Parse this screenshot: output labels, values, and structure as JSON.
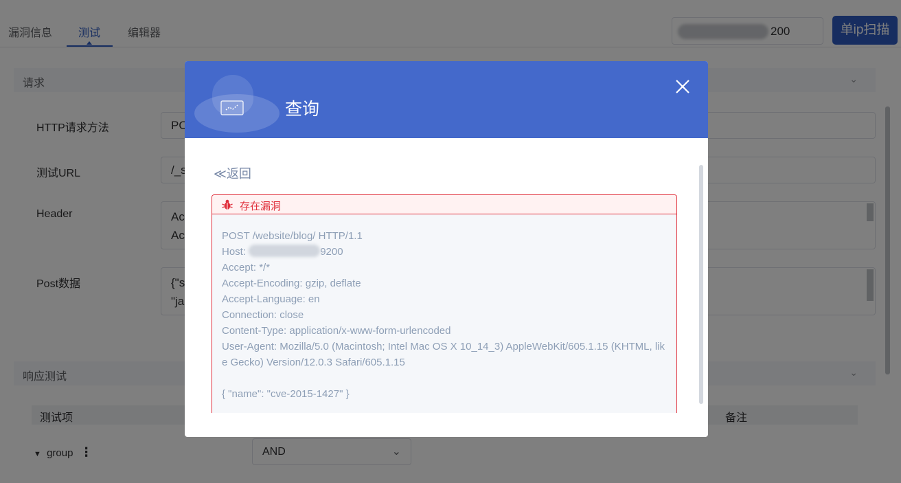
{
  "tabs": [
    {
      "label": "漏洞信息",
      "active": false
    },
    {
      "label": "测试",
      "active": true
    },
    {
      "label": "编辑器",
      "active": false
    }
  ],
  "ip_input": {
    "value_suffix": "200"
  },
  "scan_button": {
    "label": "单ip扫描"
  },
  "sections": {
    "request": {
      "title": "请求"
    },
    "response": {
      "title": "响应测试"
    }
  },
  "form": {
    "method": {
      "label": "HTTP请求方法",
      "value": "PO"
    },
    "url": {
      "label": "测试URL",
      "value": "/_s"
    },
    "header": {
      "label": "Header",
      "value_lines": [
        "Ac",
        "Ac"
      ]
    },
    "post": {
      "label": "Post数据",
      "value_lines": [
        "{\"s",
        "\"ja"
      ]
    }
  },
  "table": {
    "col_test_item": "测试项",
    "col_remark": "备注",
    "group_label": "group",
    "group_operator": "AND"
  },
  "modal": {
    "title": "查询",
    "back_label": "≪返回",
    "vuln_title": "存在漏洞",
    "request_lines": [
      "POST /website/blog/ HTTP/1.1",
      "Accept: */*",
      "Accept-Encoding: gzip, deflate",
      "Accept-Language: en",
      "Connection: close",
      "Content-Type: application/x-www-form-urlencoded",
      "User-Agent: Mozilla/5.0 (Macintosh; Intel Mac OS X 10_14_3) AppleWebKit/605.1.15 (KHTML, like Gecko) Version/12.0.3 Safari/605.1.15",
      "",
      "{ \"name\": \"cve-2015-1427\" }"
    ],
    "host_label": "Host:",
    "host_port_suffix": "9200"
  },
  "colors": {
    "primary": "#2f5bc1",
    "modal_header": "#4469cb",
    "danger": "#e0303c",
    "request_text": "#8e9fb6"
  }
}
